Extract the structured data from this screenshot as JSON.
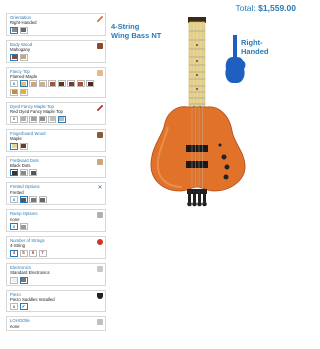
{
  "total": {
    "label": "Total:",
    "amount": "$1,559.00"
  },
  "model": {
    "line1": "4-String",
    "line2": "Wing Bass NT"
  },
  "handedness": {
    "line1": "Right-",
    "line2": "Handed"
  },
  "options": [
    {
      "title": "Orientation",
      "value": "Right-Handed"
    },
    {
      "title": "Body Wood",
      "value": "Mahogany"
    },
    {
      "title": "Fancy Top",
      "value": "Flamed Maple"
    },
    {
      "title": "Dyed Fancy Maple Top",
      "value": "Red Dyed Fancy Maple Top"
    },
    {
      "title": "Fingerboard Wood",
      "value": "Maple"
    },
    {
      "title": "Fretboard Dots",
      "value": "Black Dots"
    },
    {
      "title": "Fretted Options",
      "value": "Fretted"
    },
    {
      "title": "Ramp Options",
      "value": "none"
    },
    {
      "title": "Number of Strings",
      "value": "4-String"
    },
    {
      "title": "Electronics",
      "value": "Standard Electronics"
    },
    {
      "title": "Piezo",
      "value": "Piezo Saddles Installed"
    },
    {
      "title": "LOHOOlle",
      "value": "none"
    }
  ],
  "strings_options": [
    "4",
    "5",
    "6",
    "7"
  ],
  "colors": {
    "accent": "#2a7ab8",
    "body_orange": "#e0722a",
    "fretboard": "#e9d48a"
  }
}
